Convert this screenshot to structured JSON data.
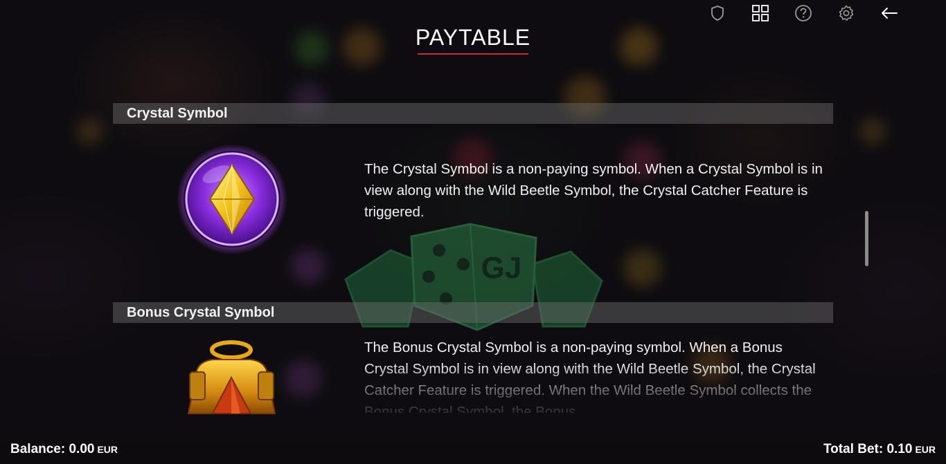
{
  "header": {
    "title": "PAYTABLE",
    "icons": [
      "shield-icon",
      "grid-icon",
      "help-icon",
      "settings-icon",
      "back-arrow-icon"
    ],
    "accent_color": "#c42a3a"
  },
  "sections": [
    {
      "title": "Crystal Symbol",
      "icon": "crystal-symbol-icon",
      "description": "The Crystal Symbol is a non-paying symbol. When a Crystal Symbol is in view along with the Wild Beetle Symbol, the Crystal Catcher Feature is triggered."
    },
    {
      "title": "Bonus Crystal Symbol",
      "icon": "bonus-crystal-symbol-icon",
      "description": "The Bonus Crystal Symbol is a non-paying symbol. When a Bonus Crystal Symbol is in view along with the Wild Beetle Symbol, the Crystal Catcher Feature is triggered. When the Wild Beetle Symbol collects the Bonus Crystal Symbol, the Bonus"
    }
  ],
  "footer": {
    "balance_label": "Balance:",
    "balance_value": "0.00",
    "balance_currency": "EUR",
    "total_bet_label": "Total Bet:",
    "total_bet_value": "0.10",
    "total_bet_currency": "EUR"
  }
}
